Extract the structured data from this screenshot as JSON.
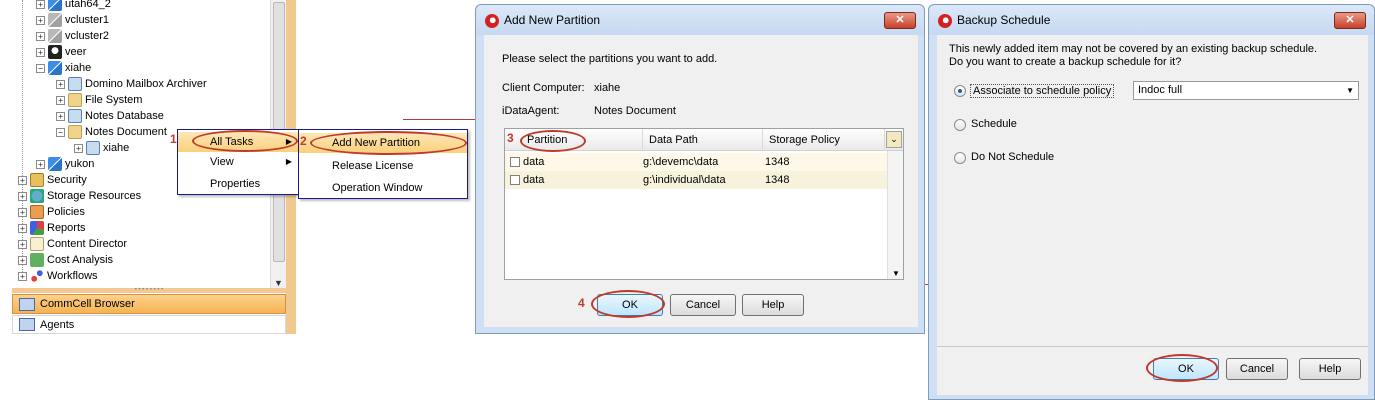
{
  "tree": {
    "items": [
      {
        "label": "utah64_2",
        "icon": "windows-icon"
      },
      {
        "label": "vcluster1",
        "icon": "windows-grey-icon"
      },
      {
        "label": "vcluster2",
        "icon": "windows-grey-icon"
      },
      {
        "label": "veer",
        "icon": "linux-icon"
      },
      {
        "label": "xiahe",
        "icon": "windows-icon"
      },
      {
        "label": "Domino Mailbox Archiver",
        "icon": "archiver-icon"
      },
      {
        "label": "File System",
        "icon": "file-system-icon"
      },
      {
        "label": "Notes Database",
        "icon": "notes-database-icon"
      },
      {
        "label": "Notes Document",
        "icon": "notes-document-icon"
      },
      {
        "label": "xiahe",
        "icon": "backupset-icon"
      },
      {
        "label": "yukon",
        "icon": "windows-icon"
      },
      {
        "label": "Security",
        "icon": "lock-icon"
      },
      {
        "label": "Storage Resources",
        "icon": "globe-icon"
      },
      {
        "label": "Policies",
        "icon": "policy-icon"
      },
      {
        "label": "Reports",
        "icon": "pie-icon"
      },
      {
        "label": "Content Director",
        "icon": "document-icon"
      },
      {
        "label": "Cost Analysis",
        "icon": "cost-icon"
      },
      {
        "label": "Workflows",
        "icon": "workflow-icon"
      }
    ],
    "bottom_tabs": [
      "CommCell Browser",
      "Agents"
    ]
  },
  "context_menu": {
    "items": [
      "All Tasks",
      "View",
      "Properties"
    ],
    "submenu": [
      "Add New Partition",
      "Release License",
      "Operation Window"
    ]
  },
  "steps": [
    "1",
    "2",
    "3",
    "4"
  ],
  "partition_dialog": {
    "title": "Add New Partition",
    "instruction": "Please select the partitions you want to add.",
    "client_label": "Client Computer:",
    "client_value": "xiahe",
    "agent_label": "iDataAgent:",
    "agent_value": "Notes Document",
    "columns": [
      "Partition",
      "Data Path",
      "Storage Policy"
    ],
    "rows": [
      {
        "partition": "data",
        "path": "g:\\devemc\\data",
        "policy": "1348"
      },
      {
        "partition": "data",
        "path": "g:\\individual\\data",
        "policy": "1348"
      }
    ],
    "buttons": {
      "ok": "OK",
      "cancel": "Cancel",
      "help": "Help"
    }
  },
  "schedule_dialog": {
    "title": "Backup Schedule",
    "message_line1": "This newly added item may not be covered by an existing backup schedule.",
    "message_line2": "Do you want to create a backup schedule for it?",
    "options": [
      "Associate to schedule policy",
      "Schedule",
      "Do Not Schedule"
    ],
    "selected_option": "Associate to schedule policy",
    "policy_value": "Indoc full",
    "buttons": {
      "ok": "OK",
      "cancel": "Cancel",
      "help": "Help"
    }
  },
  "colors": {
    "accent_red": "#c0392b",
    "highlight": "#fbd07a",
    "dialog_frame": "#cfe0f5"
  }
}
